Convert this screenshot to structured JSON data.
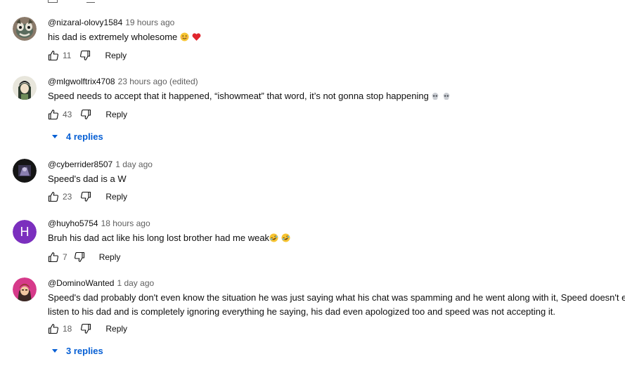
{
  "comments": [
    {
      "author": "@nizaral-olovy1584",
      "time": "19 hours ago",
      "text": "his dad is extremely wholesome",
      "likes": "11",
      "reply_label": "Reply",
      "emojis": [
        "smiling-face",
        "red-heart"
      ]
    },
    {
      "author": "@mlgwolftrix4708",
      "time": "23 hours ago (edited)",
      "text": "Speed needs to accept that it happened, “ishowmeat” that word, it’s not gonna stop happening",
      "likes": "43",
      "reply_label": "Reply",
      "emojis": [
        "skull",
        "skull"
      ],
      "replies_label": "4 replies"
    },
    {
      "author": "@cyberrider8507",
      "time": "1 day ago",
      "text": "Speed's dad is a W",
      "likes": "23",
      "reply_label": "Reply"
    },
    {
      "author": "@huyho5754",
      "time": "18 hours ago",
      "text": "Bruh his dad act like his long lost brother had me weak",
      "likes": "7",
      "reply_label": "Reply",
      "avatar_letter": "H",
      "avatar_color": "#7b2fbe",
      "emojis": [
        "rofl",
        "rofl"
      ]
    },
    {
      "author": "@DominoWanted",
      "time": "1 day ago",
      "text_line1": "Speed's dad probably don't even know the situation he was just saying what his chat was spamming and he went along with it, Speed doesn't even",
      "text_line2": "listen to his dad and is completely ignoring everything he saying, his dad even apologized too and speed was not accepting it.",
      "likes": "18",
      "reply_label": "Reply",
      "replies_label": "3 replies"
    }
  ],
  "colors": {
    "link_blue": "#065fd4",
    "meta_gray": "#606060"
  }
}
